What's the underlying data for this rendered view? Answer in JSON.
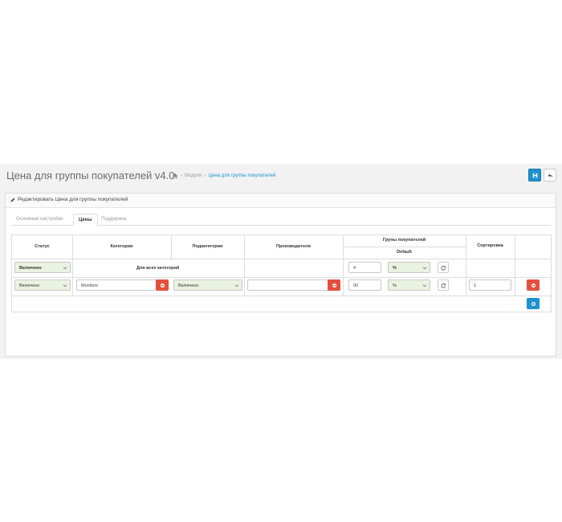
{
  "header": {
    "title": "Цена для группы покупателей v4.0",
    "breadcrumb": [
      {
        "label": "Модули"
      },
      {
        "label": "Цена для группы покупателей"
      }
    ]
  },
  "panel": {
    "title": "Редактировать Цена для группы покупателей"
  },
  "tabs": [
    {
      "label": "Основные настройки"
    },
    {
      "label": "Цены"
    },
    {
      "label": "Поддержка"
    }
  ],
  "table": {
    "headers": {
      "status": "Статус",
      "categories": "Категории",
      "subcategories": "Подкатегории",
      "manufacturers": "Производители",
      "customer_groups": "Групы покупателей",
      "group_default": "Default",
      "sort": "Сортировка"
    },
    "row_all": {
      "status": "Включено",
      "categories_note": "Для всех категорий",
      "value": "4",
      "type": "%"
    },
    "row_1": {
      "status": "Включено",
      "category": "Monitors",
      "subcategory": "Включено",
      "manufacturer": "",
      "value": "90",
      "type": "%",
      "sort": "1"
    }
  },
  "colors": {
    "primary": "#1e91cf",
    "danger": "#e3503e",
    "select_bg": "#eaf2e0"
  }
}
